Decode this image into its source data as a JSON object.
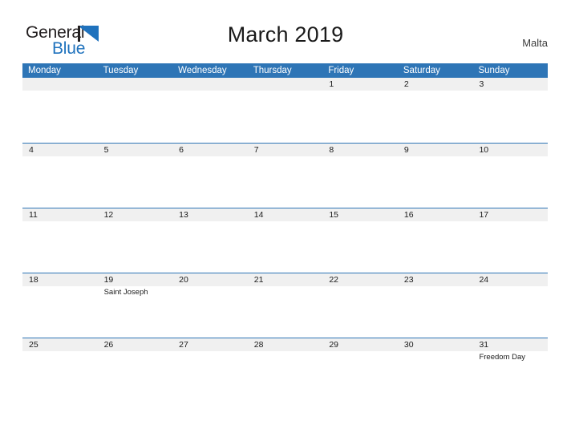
{
  "brand": {
    "name_part1": "General",
    "name_part2": "Blue",
    "flag_color": "#1f72bd",
    "text_color": "#231f20"
  },
  "header": {
    "title": "March 2019",
    "region": "Malta"
  },
  "theme": {
    "header_blue": "#2e75b6",
    "date_band_gray": "#f0f0f0",
    "page_background": "#ffffff",
    "text_color": "#1a1a1a"
  },
  "calendar": {
    "weekdays": [
      "Monday",
      "Tuesday",
      "Wednesday",
      "Thursday",
      "Friday",
      "Saturday",
      "Sunday"
    ],
    "weeks": [
      {
        "days": [
          {
            "date": "",
            "event": ""
          },
          {
            "date": "",
            "event": ""
          },
          {
            "date": "",
            "event": ""
          },
          {
            "date": "",
            "event": ""
          },
          {
            "date": "1",
            "event": ""
          },
          {
            "date": "2",
            "event": ""
          },
          {
            "date": "3",
            "event": ""
          }
        ]
      },
      {
        "days": [
          {
            "date": "4",
            "event": ""
          },
          {
            "date": "5",
            "event": ""
          },
          {
            "date": "6",
            "event": ""
          },
          {
            "date": "7",
            "event": ""
          },
          {
            "date": "8",
            "event": ""
          },
          {
            "date": "9",
            "event": ""
          },
          {
            "date": "10",
            "event": ""
          }
        ]
      },
      {
        "days": [
          {
            "date": "11",
            "event": ""
          },
          {
            "date": "12",
            "event": ""
          },
          {
            "date": "13",
            "event": ""
          },
          {
            "date": "14",
            "event": ""
          },
          {
            "date": "15",
            "event": ""
          },
          {
            "date": "16",
            "event": ""
          },
          {
            "date": "17",
            "event": ""
          }
        ]
      },
      {
        "days": [
          {
            "date": "18",
            "event": ""
          },
          {
            "date": "19",
            "event": "Saint Joseph"
          },
          {
            "date": "20",
            "event": ""
          },
          {
            "date": "21",
            "event": ""
          },
          {
            "date": "22",
            "event": ""
          },
          {
            "date": "23",
            "event": ""
          },
          {
            "date": "24",
            "event": ""
          }
        ]
      },
      {
        "days": [
          {
            "date": "25",
            "event": ""
          },
          {
            "date": "26",
            "event": ""
          },
          {
            "date": "27",
            "event": ""
          },
          {
            "date": "28",
            "event": ""
          },
          {
            "date": "29",
            "event": ""
          },
          {
            "date": "30",
            "event": ""
          },
          {
            "date": "31",
            "event": "Freedom Day"
          }
        ]
      }
    ]
  }
}
